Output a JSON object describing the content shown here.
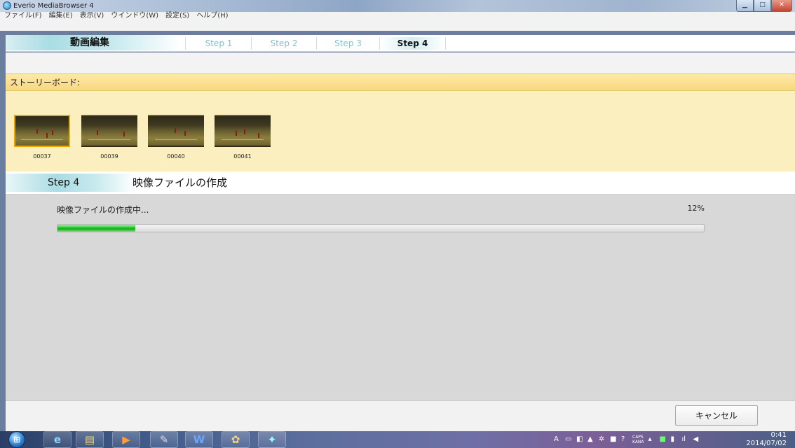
{
  "window": {
    "title": "Everio MediaBrowser 4"
  },
  "menu": {
    "items": [
      "ファイル(F)",
      "編集(E)",
      "表示(V)",
      "ウインドウ(W)",
      "設定(S)",
      "ヘルプ(H)"
    ]
  },
  "steps": {
    "main": "動画編集",
    "tabs": [
      "Step 1",
      "Step 2",
      "Step 3",
      "Step 4"
    ],
    "active": "Step 4"
  },
  "storyboard": {
    "header": "ストーリーボード:",
    "clips": [
      "00037",
      "00039",
      "00040",
      "00041"
    ]
  },
  "step4": {
    "label": "Step 4",
    "title": "映像ファイルの作成"
  },
  "progress": {
    "label": "映像ファイルの作成中...",
    "percent_text": "12%",
    "value": 0.12
  },
  "footer": {
    "cancel_label": "キャンセル"
  },
  "taskbar": {
    "time": "0:41",
    "date": "2014/07/02",
    "tray_labels": [
      "CAPS",
      "KANA"
    ]
  },
  "colors": {
    "progress_fill": "#29c12c",
    "storyboard_bg": "#fcefbf",
    "selected_border": "#f0a600"
  }
}
